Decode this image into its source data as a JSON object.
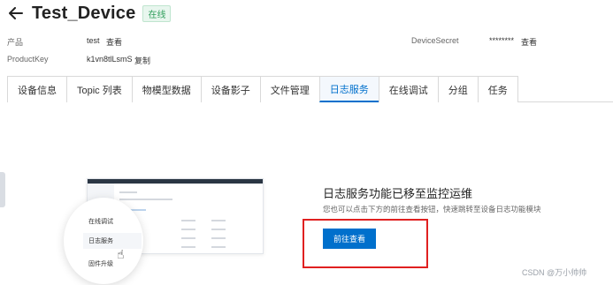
{
  "header": {
    "back_icon": "arrow-left-icon",
    "title": "Test_Device",
    "status": "在线"
  },
  "meta": {
    "product_label": "产品",
    "product_value": "test",
    "product_link": "查看",
    "productkey_label": "ProductKey",
    "productkey_value": "k1vn8tlLsmS",
    "productkey_link": "复制",
    "secret_label": "DeviceSecret",
    "secret_value": "********",
    "secret_link": "查看"
  },
  "tabs": [
    {
      "label": "设备信息"
    },
    {
      "label": "Topic 列表"
    },
    {
      "label": "物模型数据"
    },
    {
      "label": "设备影子"
    },
    {
      "label": "文件管理"
    },
    {
      "label": "日志服务",
      "active": true
    },
    {
      "label": "在线调试"
    },
    {
      "label": "分组"
    },
    {
      "label": "任务"
    }
  ],
  "illustration": {
    "menu_items": [
      "在线调试",
      "日志服务",
      "固件升级"
    ],
    "cursor_icon": "hand-pointer-icon"
  },
  "notice": {
    "title": "日志服务功能已移至监控运维",
    "description": "您也可以点击下方的前往查看按钮，快速跳转至设备日志功能模块",
    "button_label": "前往查看"
  },
  "watermark": "CSDN @万小帅帅",
  "colors": {
    "accent": "#0070cc",
    "status_green": "#2f9e5b",
    "highlight_red": "#e02020"
  }
}
